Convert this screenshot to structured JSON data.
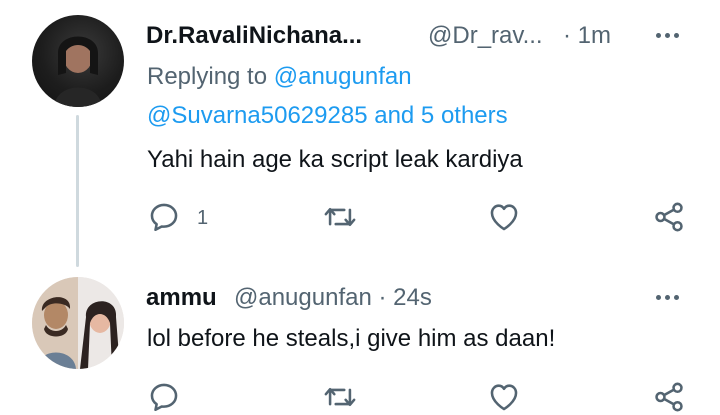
{
  "tweet1": {
    "display_name": "Dr.RavaliNichana...",
    "handle": "@Dr_rav...",
    "time": "· 1m",
    "replying_prefix": "Replying to",
    "replying_user1": "@anugunfan",
    "replying_user2": "@Suvarna50629285",
    "replying_others": "and 5 others",
    "text": "Yahi hain age ka script leak kardiya",
    "reply_count": "1"
  },
  "tweet2": {
    "display_name": "ammu",
    "handle": "@anugunfan · 24s",
    "text": "lol before he steals,i give him as daan!"
  },
  "icons": {
    "reply": "reply-icon",
    "retweet": "retweet-icon",
    "like": "heart-icon",
    "share": "share-icon",
    "more": "more-icon"
  },
  "colors": {
    "link": "#1d9bf0",
    "muted": "#536471",
    "text": "#0f1419"
  }
}
